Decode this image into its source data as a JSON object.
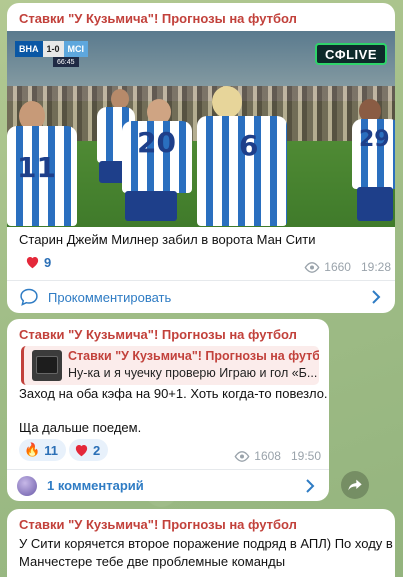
{
  "messages": [
    {
      "author": "Ставки \"У Кузьмича\"! Прогнозы на футбол",
      "media": {
        "score_home": "BHA",
        "score_value": "1-0",
        "score_away": "MCI",
        "match_time": "66:45",
        "broadcaster": "CΦLIVE",
        "shirt_numbers": [
          "11",
          "20",
          "6",
          "29"
        ]
      },
      "text": "Старин Джейм Милнер забил в ворота Ман Сити",
      "reactions": [
        {
          "emoji": "heart",
          "count": "9"
        }
      ],
      "views": "1660",
      "time": "19:28",
      "comment_action": "Прокомментировать"
    },
    {
      "author": "Ставки \"У Кузьмича\"! Прогнозы на футбол",
      "reply": {
        "author": "Ставки \"У Кузьмича\"! Прогнозы на футбол",
        "text": "Ну-ка и я чуечку проверю  Играю и гол «Б..."
      },
      "text_line1": "Заход на оба кэфа на 90+1. Хоть когда-то повезло.",
      "text_line2": "Ща дальше поедем.",
      "reactions": [
        {
          "emoji": "fire",
          "count": "11"
        },
        {
          "emoji": "heart",
          "count": "2"
        }
      ],
      "views": "1608",
      "time": "19:50",
      "comments": "1 комментарий"
    },
    {
      "author": "Ставки \"У Кузьмича\"! Прогнозы на футбол",
      "text_line1": "У Сити корячется второе поражение подряд в АПЛ) По ходу в",
      "text_line2": "Манчестере тебе две проблемные команды"
    }
  ],
  "colors": {
    "author": "#c2413b",
    "link": "#2f7cc4",
    "reaction_bg": "#e8f1fb",
    "meta": "#9aa3ab"
  }
}
